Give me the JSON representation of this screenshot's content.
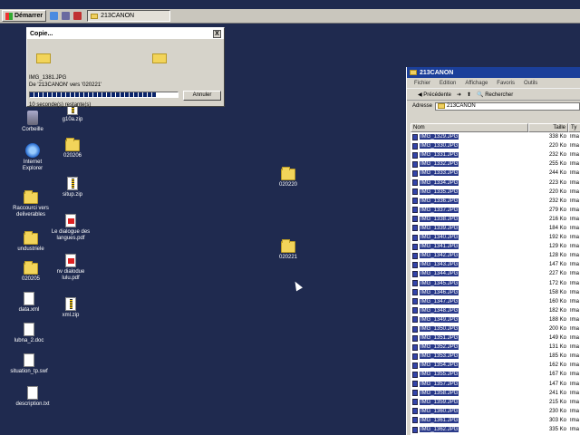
{
  "taskbar": {
    "start_label": "Démarrer",
    "task_label": "213CANON"
  },
  "desktop_icons": [
    {
      "label": "Corbeille"
    },
    {
      "label": "Internet Explorer"
    },
    {
      "label": "Raccourci vers deliverables"
    },
    {
      "label": "undustriele"
    },
    {
      "label": "020205"
    },
    {
      "label": "data.xml"
    },
    {
      "label": "lubna_2.doc"
    },
    {
      "label": "situation_tp.swf"
    },
    {
      "label": "description.txt"
    },
    {
      "label": "g10a.zip"
    },
    {
      "label": "020206"
    },
    {
      "label": "situp.zip"
    },
    {
      "label": "Le dialogue des langues.pdf"
    },
    {
      "label": "nv dialodue lulu.pdf"
    },
    {
      "label": "xml.zip"
    },
    {
      "label": "020220"
    },
    {
      "label": "020221"
    }
  ],
  "copy_dialog": {
    "title": "Copie...",
    "close": "X",
    "file": "IMG_1381.JPG",
    "detail": "De '213CANON' vers '020221'",
    "progress": 0.85,
    "cancel_label": "Annuler",
    "remaining": "10 seconde(s) restante(s)"
  },
  "explorer": {
    "title": "213CANON",
    "menu": [
      "Fichier",
      "Edition",
      "Affichage",
      "Favoris",
      "Outils"
    ],
    "back_label": "Précédente",
    "search_label": "Rechercher",
    "address_label": "Adresse",
    "address_value": "213CANON",
    "columns": {
      "name": "Nom",
      "size": "Taille",
      "type": "Ty"
    },
    "files": [
      {
        "name": "IMG_1329.JPG",
        "size": "338 Ko",
        "type": "Ima"
      },
      {
        "name": "IMG_1330.JPG",
        "size": "220 Ko",
        "type": "Ima"
      },
      {
        "name": "IMG_1331.JPG",
        "size": "232 Ko",
        "type": "Ima"
      },
      {
        "name": "IMG_1332.JPG",
        "size": "255 Ko",
        "type": "Ima"
      },
      {
        "name": "IMG_1333.JPG",
        "size": "244 Ko",
        "type": "Ima"
      },
      {
        "name": "IMG_1334.JPG",
        "size": "223 Ko",
        "type": "Ima"
      },
      {
        "name": "IMG_1335.JPG",
        "size": "220 Ko",
        "type": "Ima"
      },
      {
        "name": "IMG_1336.JPG",
        "size": "232 Ko",
        "type": "Ima"
      },
      {
        "name": "IMG_1337.JPG",
        "size": "279 Ko",
        "type": "Ima"
      },
      {
        "name": "IMG_1338.JPG",
        "size": "216 Ko",
        "type": "Ima"
      },
      {
        "name": "IMG_1339.JPG",
        "size": "184 Ko",
        "type": "Ima"
      },
      {
        "name": "IMG_1340.JPG",
        "size": "192 Ko",
        "type": "Ima"
      },
      {
        "name": "IMG_1341.JPG",
        "size": "129 Ko",
        "type": "Ima"
      },
      {
        "name": "IMG_1342.JPG",
        "size": "128 Ko",
        "type": "Ima"
      },
      {
        "name": "IMG_1343.JPG",
        "size": "147 Ko",
        "type": "Ima"
      },
      {
        "name": "IMG_1344.JPG",
        "size": "227 Ko",
        "type": "Ima"
      },
      {
        "name": "IMG_1345.JPG",
        "size": "172 Ko",
        "type": "Ima"
      },
      {
        "name": "IMG_1346.JPG",
        "size": "158 Ko",
        "type": "Ima"
      },
      {
        "name": "IMG_1347.JPG",
        "size": "160 Ko",
        "type": "Ima"
      },
      {
        "name": "IMG_1348.JPG",
        "size": "182 Ko",
        "type": "Ima"
      },
      {
        "name": "IMG_1349.JPG",
        "size": "188 Ko",
        "type": "Ima"
      },
      {
        "name": "IMG_1350.JPG",
        "size": "200 Ko",
        "type": "Ima"
      },
      {
        "name": "IMG_1351.JPG",
        "size": "149 Ko",
        "type": "Ima"
      },
      {
        "name": "IMG_1352.JPG",
        "size": "131 Ko",
        "type": "Ima"
      },
      {
        "name": "IMG_1353.JPG",
        "size": "185 Ko",
        "type": "Ima"
      },
      {
        "name": "IMG_1354.JPG",
        "size": "162 Ko",
        "type": "Ima"
      },
      {
        "name": "IMG_1355.JPG",
        "size": "167 Ko",
        "type": "Ima"
      },
      {
        "name": "IMG_1357.JPG",
        "size": "147 Ko",
        "type": "Ima"
      },
      {
        "name": "IMG_1358.JPG",
        "size": "241 Ko",
        "type": "Ima"
      },
      {
        "name": "IMG_1359.JPG",
        "size": "215 Ko",
        "type": "Ima"
      },
      {
        "name": "IMG_1360.JPG",
        "size": "230 Ko",
        "type": "Ima"
      },
      {
        "name": "IMG_1361.JPG",
        "size": "303 Ko",
        "type": "Ima"
      },
      {
        "name": "IMG_1362.JPG",
        "size": "335 Ko",
        "type": "Ima"
      }
    ]
  },
  "colors": {
    "desktop": "#1f2a4f",
    "titlebar": "#1b3f9a",
    "selection": "#2a3a8a"
  }
}
